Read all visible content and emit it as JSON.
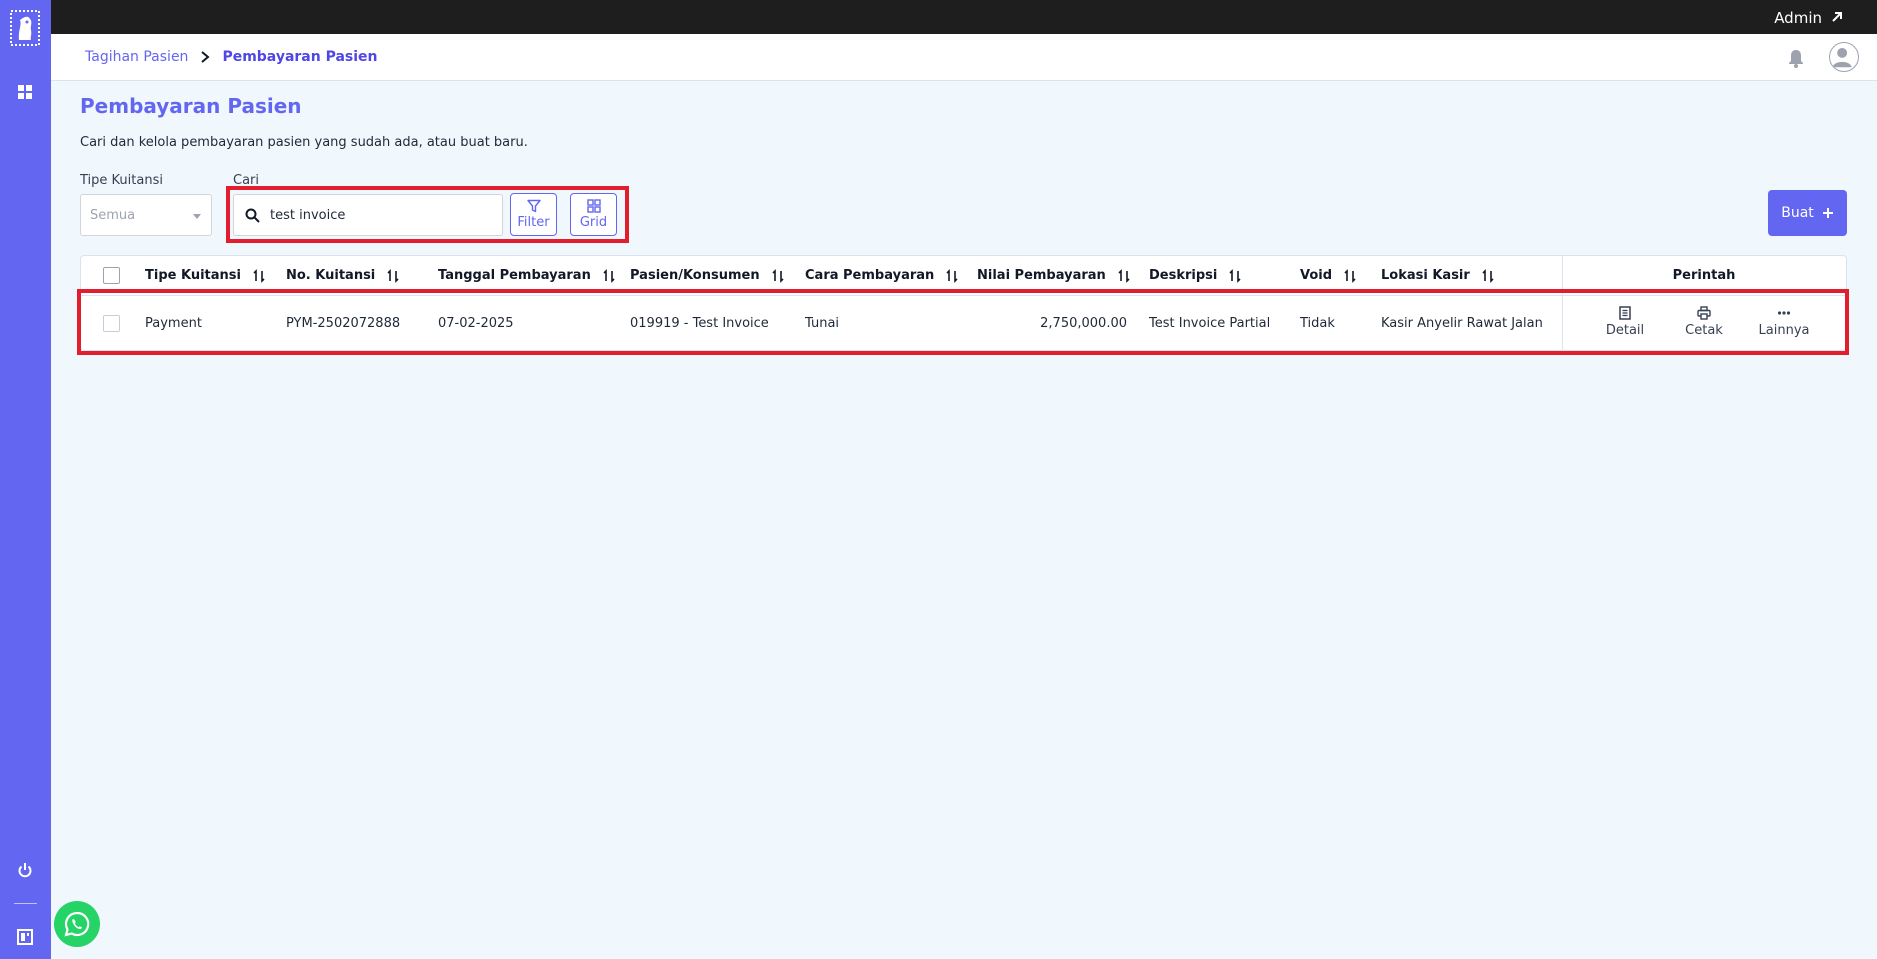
{
  "topbar": {
    "user_label": "Admin",
    "external_icon": "arrow-up-right-icon"
  },
  "sidebar": {
    "logo": "app-logo",
    "items": [
      {
        "icon": "dashboard-grid-icon"
      },
      {
        "icon": "power-icon"
      },
      {
        "icon": "layout-icon"
      }
    ],
    "color": "#6366f1"
  },
  "header": {
    "breadcrumb": [
      {
        "label": "Tagihan Pasien"
      },
      {
        "label": "Pembayaran Pasien"
      }
    ],
    "bell_icon": "bell-icon",
    "avatar_icon": "user-avatar-icon"
  },
  "page": {
    "title": "Pembayaran Pasien",
    "subtitle": "Cari dan kelola pembayaran pasien yang sudah ada, atau buat baru."
  },
  "filters": {
    "tipe_label": "Tipe Kuitansi",
    "tipe_value": "Semua",
    "cari_label": "Cari",
    "search_value": "test invoice",
    "filter_label": "Filter",
    "grid_label": "Grid",
    "buat_label": "Buat"
  },
  "table": {
    "headers": {
      "tipe": "Tipe Kuitansi",
      "no": "No. Kuitansi",
      "tanggal": "Tanggal Pembayaran",
      "pasien": "Pasien/Konsumen",
      "cara": "Cara Pembayaran",
      "nilai": "Nilai Pembayaran",
      "deskripsi": "Deskripsi",
      "void": "Void",
      "lokasi": "Lokasi Kasir",
      "perintah": "Perintah"
    },
    "rows": [
      {
        "tipe": "Payment",
        "no": "PYM-2502072888",
        "tanggal": "07-02-2025",
        "pasien": "019919 - Test Invoice",
        "cara": "Tunai",
        "nilai": "2,750,000.00",
        "deskripsi": "Test Invoice Partial",
        "void": "Tidak",
        "lokasi": "Kasir Anyelir Rawat Jalan",
        "actions": {
          "detail": "Detail",
          "cetak": "Cetak",
          "lainnya": "Lainnya"
        }
      }
    ]
  },
  "colors": {
    "accent": "#6366f1",
    "highlight": "#e11d2e",
    "whatsapp": "#25d366"
  }
}
